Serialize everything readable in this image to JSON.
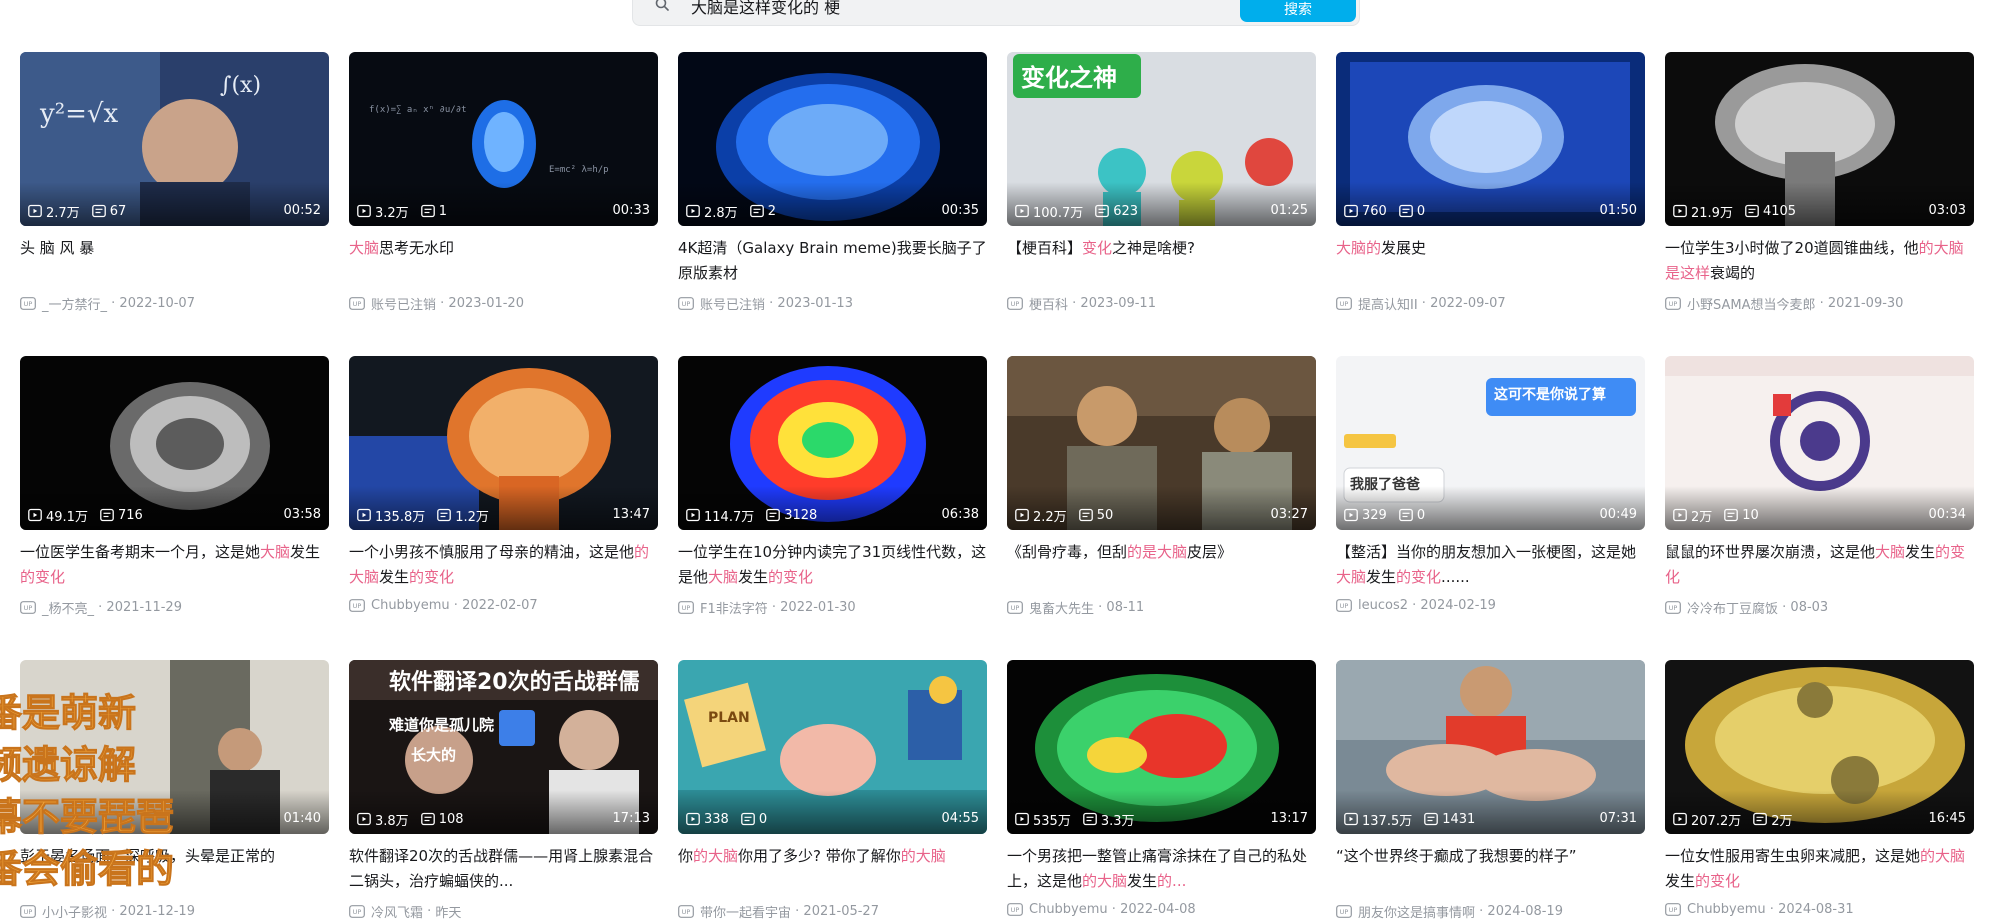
{
  "search": {
    "query": "大脑是这样变化的 梗",
    "button_label": "搜索"
  },
  "cards": [
    {
      "views": "2.7万",
      "danmaku": "67",
      "duration": "00:52",
      "title": [
        {
          "t": "头 脑 风 暴"
        }
      ],
      "author": "_一方禁行_",
      "date": "2022-10-07"
    },
    {
      "views": "3.2万",
      "danmaku": "1",
      "duration": "00:33",
      "title": [
        {
          "t": "大脑",
          "hl": true
        },
        {
          "t": "思考无水印"
        }
      ],
      "author": "账号已注销",
      "date": "2023-01-20"
    },
    {
      "views": "2.8万",
      "danmaku": "2",
      "duration": "00:35",
      "title": [
        {
          "t": "4K超清（Galaxy Brain meme)我要长脑子了原版素材"
        }
      ],
      "author": "账号已注销",
      "date": "2023-01-13"
    },
    {
      "views": "100.7万",
      "danmaku": "623",
      "duration": "01:25",
      "title": [
        {
          "t": "【梗百科】"
        },
        {
          "t": "变化",
          "hl": true
        },
        {
          "t": "之神是啥梗?"
        }
      ],
      "author": "梗百科",
      "date": "2023-09-11"
    },
    {
      "views": "760",
      "danmaku": "0",
      "duration": "01:50",
      "title": [
        {
          "t": "大脑的",
          "hl": true
        },
        {
          "t": "发展史"
        }
      ],
      "author": "提高认知II",
      "date": "2022-09-07"
    },
    {
      "views": "21.9万",
      "danmaku": "4105",
      "duration": "03:03",
      "title": [
        {
          "t": "一位学生3小时做了20道圆锥曲线，他"
        },
        {
          "t": "的大脑是这样",
          "hl": true
        },
        {
          "t": "衰竭的"
        }
      ],
      "author": "小野SAMA想当今麦郎",
      "date": "2021-09-30"
    },
    {
      "views": "49.1万",
      "danmaku": "716",
      "duration": "03:58",
      "title": [
        {
          "t": "一位医学生备考期末一个月，这是她"
        },
        {
          "t": "大脑",
          "hl": true
        },
        {
          "t": "发生"
        },
        {
          "t": "的变化",
          "hl": true
        }
      ],
      "author": "_杨不亮_",
      "date": "2021-11-29"
    },
    {
      "views": "135.8万",
      "danmaku": "1.2万",
      "duration": "13:47",
      "title": [
        {
          "t": "一个小男孩不慎服用了母亲的精油，这是他"
        },
        {
          "t": "的大脑",
          "hl": true
        },
        {
          "t": "发生"
        },
        {
          "t": "的变化",
          "hl": true
        }
      ],
      "author": "Chubbyemu",
      "date": "2022-02-07"
    },
    {
      "views": "114.7万",
      "danmaku": "3128",
      "duration": "06:38",
      "title": [
        {
          "t": "一位学生在10分钟内读完了31页线性代数，这是他"
        },
        {
          "t": "大脑",
          "hl": true
        },
        {
          "t": "发生"
        },
        {
          "t": "的变化",
          "hl": true
        }
      ],
      "author": "F1非法字符",
      "date": "2022-01-30"
    },
    {
      "views": "2.2万",
      "danmaku": "50",
      "duration": "03:27",
      "title": [
        {
          "t": "《刮骨疗毒，但刮"
        },
        {
          "t": "的是大脑",
          "hl": true
        },
        {
          "t": "皮层》"
        }
      ],
      "author": "鬼畜大先生",
      "date": "08-11"
    },
    {
      "views": "329",
      "danmaku": "0",
      "duration": "00:49",
      "title": [
        {
          "t": "【整活】当你的朋友想加入一张梗图，这是她"
        },
        {
          "t": "大脑",
          "hl": true
        },
        {
          "t": "发生"
        },
        {
          "t": "的变化",
          "hl": true
        },
        {
          "t": "......"
        }
      ],
      "author": "leucos2",
      "date": "2024-02-19"
    },
    {
      "views": "2万",
      "danmaku": "10",
      "duration": "00:34",
      "title": [
        {
          "t": "鼠鼠的环世界屡次崩溃，这是他"
        },
        {
          "t": "大脑",
          "hl": true
        },
        {
          "t": "发生"
        },
        {
          "t": "的变化",
          "hl": true
        }
      ],
      "author": "冷冷布丁豆腐饭",
      "date": "08-03"
    },
    {
      "views": "",
      "danmaku": "",
      "duration": "01:40",
      "title": [
        {
          "t": "彭于晏名场面：深呼吸，头晕是正常的"
        }
      ],
      "author": "小小子影视",
      "date": "2021-12-19"
    },
    {
      "views": "3.8万",
      "danmaku": "108",
      "duration": "17:13",
      "title": [
        {
          "t": "软件翻译20次的舌战群儒——用肾上腺素混合二锅头，治疗蝙蝠侠的..."
        }
      ],
      "author": "冷风飞霜",
      "date": "昨天"
    },
    {
      "views": "338",
      "danmaku": "0",
      "duration": "04:55",
      "title": [
        {
          "t": "你"
        },
        {
          "t": "的大脑",
          "hl": true
        },
        {
          "t": "你用了多少? 带你了解你"
        },
        {
          "t": "的大脑",
          "hl": true
        }
      ],
      "author": "带你一起看宇宙",
      "date": "2021-05-27"
    },
    {
      "views": "535万",
      "danmaku": "3.3万",
      "duration": "13:17",
      "title": [
        {
          "t": "一个男孩把一整管止痛膏涂抹在了自己的私处上，这是他"
        },
        {
          "t": "的大脑",
          "hl": true
        },
        {
          "t": "发生"
        },
        {
          "t": "的...",
          "hl": true
        }
      ],
      "author": "Chubbyemu",
      "date": "2022-04-08"
    },
    {
      "views": "137.5万",
      "danmaku": "1431",
      "duration": "07:31",
      "title": [
        {
          "t": "“这个世界终于癫成了我想要的样子”"
        }
      ],
      "author": "朋友你这是搞事情啊",
      "date": "2024-08-19"
    },
    {
      "views": "207.2万",
      "danmaku": "2万",
      "duration": "16:45",
      "title": [
        {
          "t": "一位女性服用寄生虫卵来减肥，这是她"
        },
        {
          "t": "的大脑",
          "hl": true
        },
        {
          "t": "发生"
        },
        {
          "t": "的变化",
          "hl": true
        }
      ],
      "author": "Chubbyemu",
      "date": "2024-08-31"
    }
  ],
  "thumb_texts": {
    "card3": "变化之神",
    "card13": "软件翻译20次的舌战群儒",
    "card10a": "这可不是你说了算",
    "card10b": "我服了爸爸",
    "card13b": "难道你是孤儿院",
    "card13c": "长大的",
    "card12": "PLAN"
  },
  "overlay_lines": [
    "番是萌新",
    "频遗谅解",
    "幕不要琵琶",
    "番会偷看的"
  ],
  "colors": {
    "accent": "#00aeec",
    "highlight": "#e8638a",
    "meta": "#9499a0"
  }
}
